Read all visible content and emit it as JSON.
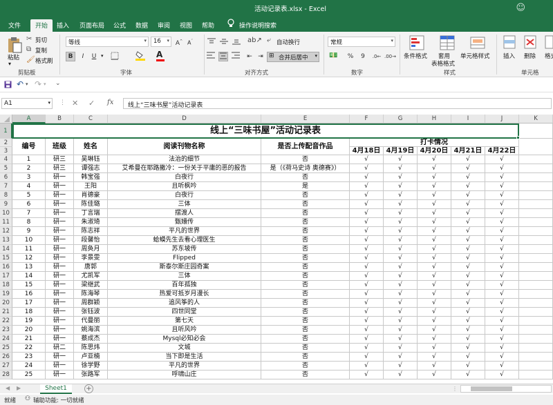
{
  "window": {
    "title": "活动记录表.xlsx  -  Excel"
  },
  "tabs": [
    "文件",
    "开始",
    "插入",
    "页面布局",
    "公式",
    "数据",
    "审阅",
    "视图",
    "帮助"
  ],
  "active_tab": "开始",
  "tell_me": "操作说明搜索",
  "ribbon": {
    "clipboard": {
      "paste": "粘贴",
      "cut": "剪切",
      "copy": "复制",
      "format_painter": "格式刷",
      "label": "剪贴板"
    },
    "font": {
      "name": "等线",
      "size": "16",
      "label": "字体",
      "bold": "B",
      "italic": "I",
      "underline": "U"
    },
    "alignment": {
      "wrap": "自动换行",
      "merge": "合并后居中",
      "label": "对齐方式"
    },
    "number": {
      "format": "常规",
      "label": "数字",
      "percent": "%",
      "comma": "9"
    },
    "styles": {
      "conditional": "条件格式",
      "table1": "套用",
      "table2": "表格格式",
      "cell_styles": "单元格样式",
      "label": "样式"
    },
    "cells": {
      "insert": "插入",
      "delete": "删除",
      "format": "格式",
      "label": "单元格"
    }
  },
  "formula_bar": {
    "name_box": "A1",
    "fx": "fx",
    "formula": "线上“三味书屋”活动记录表"
  },
  "columns": [
    "A",
    "B",
    "C",
    "D",
    "E",
    "F",
    "G",
    "H",
    "I",
    "J",
    "K"
  ],
  "sheet": {
    "title": "线上“三味书屋”活动记录表",
    "headers": {
      "no": "编号",
      "class": "班级",
      "name": "姓名",
      "book": "阅读刊物名称",
      "audio": "是否上传配音作品",
      "checkin": "打卡情况"
    },
    "dates": [
      "4月18日",
      "4月19日",
      "4月20日",
      "4月21日",
      "4月22日"
    ],
    "check": "√",
    "rows": [
      [
        "1",
        "研三",
        "吴琳钰",
        "法治的细节",
        "否"
      ],
      [
        "2",
        "研三",
        "谭强志",
        "艾希曼在耶路撒冷：一份关于平庸的恶的报告",
        "是（《荷马史诗 奥德赛》）"
      ],
      [
        "3",
        "研一",
        "韩宝强",
        "白夜行",
        "否"
      ],
      [
        "4",
        "研一",
        "王阳",
        "且听枫吟",
        "是"
      ],
      [
        "5",
        "研一",
        "肖德豪",
        "白夜行",
        "否"
      ],
      [
        "6",
        "研一",
        "陈佳璐",
        "三体",
        "否"
      ],
      [
        "7",
        "研一",
        "丁言瑞",
        "摆渡人",
        "否"
      ],
      [
        "8",
        "研一",
        "朱淑琦",
        "甄嬛传",
        "否"
      ],
      [
        "9",
        "研一",
        "陈志祥",
        "平凡的世界",
        "否"
      ],
      [
        "10",
        "研一",
        "段馨怡",
        "蛤蟆先生去看心理医生",
        "否"
      ],
      [
        "11",
        "研一",
        "周奂月",
        "苏东坡传",
        "否"
      ],
      [
        "12",
        "研一",
        "李景雯",
        "Flipped",
        "否"
      ],
      [
        "13",
        "研一",
        "唐郭",
        "斯泰尔斯庄园奇案",
        "否"
      ],
      [
        "14",
        "研一",
        "尤凯军",
        "三体",
        "否"
      ],
      [
        "15",
        "研一",
        "梁继武",
        "百年孤独",
        "否"
      ],
      [
        "16",
        "研一",
        "陈海琴",
        "热爱可抵岁月漫长",
        "否"
      ],
      [
        "17",
        "研一",
        "周群颖",
        "追风筝的人",
        "否"
      ],
      [
        "18",
        "研一",
        "张钰波",
        "四世同堂",
        "否"
      ],
      [
        "19",
        "研一",
        "代曼丽",
        "第七天",
        "否"
      ],
      [
        "20",
        "研一",
        "姚海滨",
        "且听风吟",
        "否"
      ],
      [
        "21",
        "研一",
        "蔡成杰",
        "Mysql必知必会",
        "否"
      ],
      [
        "22",
        "研二",
        "陈思炜",
        "文城",
        "否"
      ],
      [
        "23",
        "研一",
        "卢亚楠",
        "当下即是生活",
        "否"
      ],
      [
        "24",
        "研一",
        "徐学野",
        "平凡的世界",
        "否"
      ],
      [
        "25",
        "研一",
        "张路军",
        "呼啸山庄",
        "否"
      ]
    ]
  },
  "sheet_tab": "Sheet1",
  "status": {
    "ready": "就绪",
    "accessibility": "辅助功能: 一切就绪"
  },
  "colors": {
    "excel_green": "#217346"
  }
}
